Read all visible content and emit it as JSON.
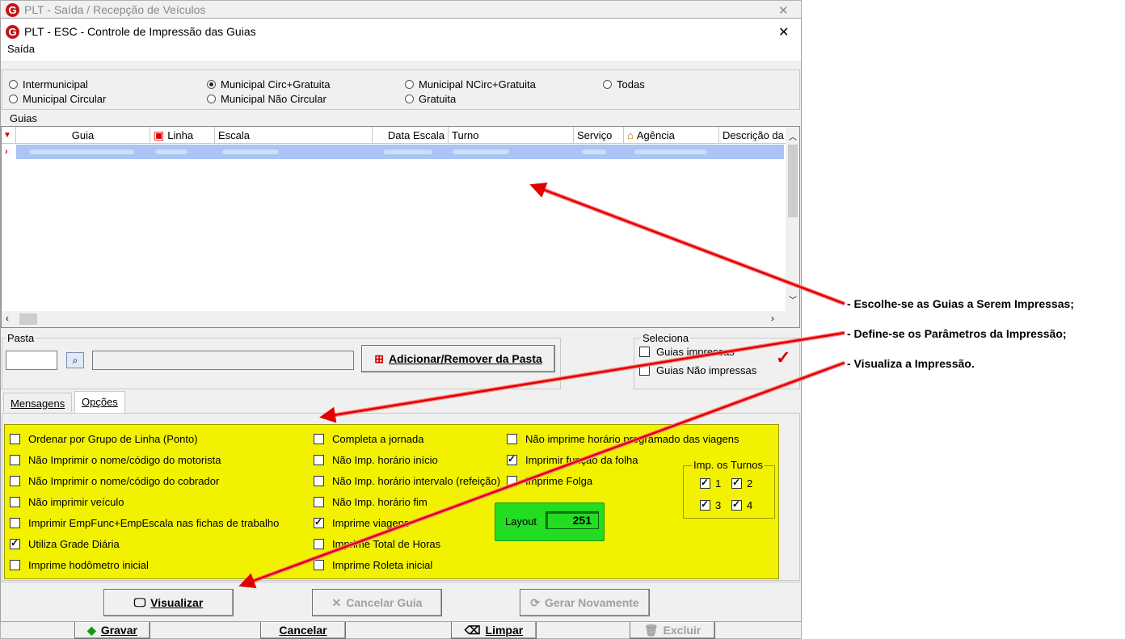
{
  "back_window": {
    "title": "PLT - Saída / Recepção de Veículos"
  },
  "window": {
    "title": "PLT -  ESC - Controle de Impressão das Guias",
    "close_glyph": "✕"
  },
  "menu": {
    "item": "Saída"
  },
  "filters": [
    {
      "label": "Intermunicipal",
      "selected": false
    },
    {
      "label": "Municipal Circular",
      "selected": false
    },
    {
      "label": "Municipal Circ+Gratuita",
      "selected": true
    },
    {
      "label": "Municipal Não Circular",
      "selected": false
    },
    {
      "label": "Municipal NCirc+Gratuita",
      "selected": false
    },
    {
      "label": "Gratuita",
      "selected": false
    },
    {
      "label": "Todas",
      "selected": false
    }
  ],
  "guias": {
    "group_title": "Guias",
    "columns": [
      "Guia",
      "Linha",
      "Escala",
      "Data Escala",
      "Turno",
      "Serviço",
      "Agência",
      "Descrição da"
    ]
  },
  "pasta": {
    "group_title": "Pasta",
    "add_remove_button": "Adicionar/Remover da Pasta"
  },
  "seleciona": {
    "group_title": "Seleciona",
    "items": [
      {
        "label": "Guias impressas",
        "checked": false
      },
      {
        "label": "Guias Não impressas",
        "checked": false
      }
    ]
  },
  "tabs": [
    {
      "label": "Mensagens",
      "active": false
    },
    {
      "label": "Opções",
      "active": true
    }
  ],
  "options": {
    "col1": [
      {
        "label": "Ordenar por Grupo de Linha (Ponto)",
        "checked": false
      },
      {
        "label": "Não Imprimir o nome/código do motorista",
        "checked": false
      },
      {
        "label": "Não Imprimir o nome/código do cobrador",
        "checked": false
      },
      {
        "label": "Não imprimir veículo",
        "checked": false
      },
      {
        "label": "Imprimir EmpFunc+EmpEscala nas fichas de trabalho",
        "checked": false
      },
      {
        "label": "Utiliza Grade Diária",
        "checked": true
      },
      {
        "label": "Imprime hodômetro inicial",
        "checked": false
      }
    ],
    "col2": [
      {
        "label": "Completa a jornada",
        "checked": false
      },
      {
        "label": "Não Imp. horário início",
        "checked": false
      },
      {
        "label": "Não Imp. horário intervalo (refeição)",
        "checked": false
      },
      {
        "label": "Não Imp. horário fim",
        "checked": false
      },
      {
        "label": "Imprime viagens",
        "checked": true
      },
      {
        "label": "Imprime Total de Horas",
        "checked": false
      },
      {
        "label": "Imprime Roleta inicial",
        "checked": false
      }
    ],
    "col3": [
      {
        "label": "Não imprime horário programado das viagens",
        "checked": false
      },
      {
        "label": "Imprimir função da folha",
        "checked": true
      },
      {
        "label": "Imprime Folga",
        "checked": false
      }
    ],
    "layout": {
      "label": "Layout",
      "value": "251"
    },
    "turnos": {
      "title": "Imp. os Turnos",
      "items": [
        {
          "label": "1",
          "checked": true
        },
        {
          "label": "2",
          "checked": true
        },
        {
          "label": "3",
          "checked": true
        },
        {
          "label": "4",
          "checked": true
        }
      ]
    }
  },
  "buttons": {
    "visualizar": "Visualizar",
    "cancelar_guia": "Cancelar Guia",
    "gerar_novamente": "Gerar Novamente"
  },
  "back_buttons": {
    "gravar": "Gravar",
    "cancelar": "Cancelar",
    "limpar": "Limpar",
    "excluir": "Excluir"
  },
  "annotations": {
    "a1": "- Escolhe-se as Guias a Serem Impressas;",
    "a2": "- Define-se os Parâmetros da Impressão;",
    "a3": "- Visualiza a Impressão."
  },
  "colors": {
    "highlight_yellow": "#f2f200",
    "layout_green": "#22dd22",
    "arrow_red": "#e00000",
    "row_selected": "#a9c4f5"
  }
}
